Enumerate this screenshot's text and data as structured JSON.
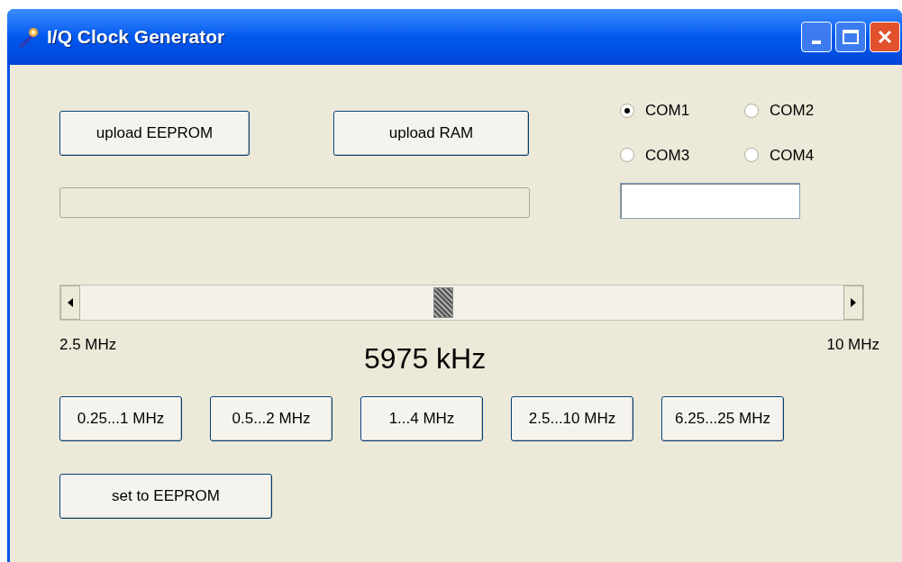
{
  "window": {
    "title": "I/Q Clock Generator"
  },
  "buttons_top": [
    "upload EEPROM",
    "upload RAM"
  ],
  "ports": [
    {
      "label": "COM1",
      "selected": true
    },
    {
      "label": "COM2",
      "selected": false
    },
    {
      "label": "COM3",
      "selected": false
    },
    {
      "label": "COM4",
      "selected": false
    }
  ],
  "frequency_slider": {
    "min_label": "2.5 MHz",
    "max_label": "10 MHz",
    "reading": "5975 kHz"
  },
  "range_buttons": [
    "0.25...1 MHz",
    "0.5...2 MHz",
    "1...4 MHz",
    "2.5...10 MHz",
    "6.25...25 MHz"
  ],
  "set_button": "set to EEPROM"
}
